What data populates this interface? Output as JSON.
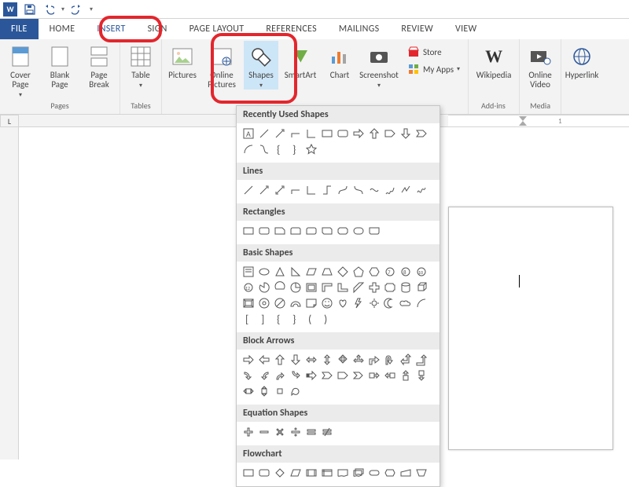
{
  "titlebar": {
    "app": "W"
  },
  "tabs": {
    "file": "FILE",
    "home": "HOME",
    "insert": "INSERT",
    "design": "SIGN",
    "layout": "PAGE LAYOUT",
    "references": "REFERENCES",
    "mailings": "MAILINGS",
    "review": "REVIEW",
    "view": "VIEW"
  },
  "ribbon": {
    "pages": {
      "label": "Pages",
      "cover": "Cover\nPage",
      "blank": "Blank\nPage",
      "break": "Page\nBreak"
    },
    "tables": {
      "label": "Tables",
      "table": "Table"
    },
    "illustrations": {
      "pictures": "Pictures",
      "online": "Online\nPictures",
      "shapes": "Shapes",
      "smartart": "SmartArt",
      "chart": "Chart",
      "screenshot": "Screenshot"
    },
    "addins": {
      "label": "Add-ins",
      "store": "Store",
      "myapps": "My Apps",
      "wikipedia": "Wikipedia"
    },
    "media": {
      "label": "Media",
      "video": "Online\nVideo"
    },
    "links": {
      "hyperlink": "Hyperlink"
    }
  },
  "shapes_panel": {
    "recent": "Recently Used Shapes",
    "lines": "Lines",
    "rectangles": "Rectangles",
    "basic": "Basic Shapes",
    "block": "Block Arrows",
    "equation": "Equation Shapes",
    "flowchart": "Flowchart"
  },
  "ruler": {
    "corner": "L",
    "tick1": "1"
  }
}
